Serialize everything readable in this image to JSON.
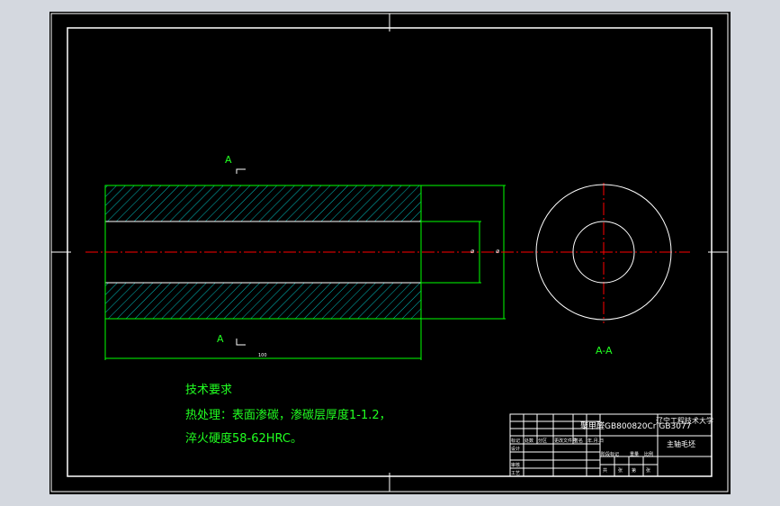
{
  "drawing": {
    "section_mark_top": "A",
    "section_mark_bottom": "A",
    "section_view_label": "A-A",
    "dim_small_1": "⌀",
    "dim_small_2": "⌀",
    "dim_length": "100"
  },
  "notes": {
    "heading": "技术要求",
    "line1": "热处理：表面渗碳，渗碳层厚度1-1.2，",
    "line2": "淬火硬度58-62HRC。"
  },
  "title_block": {
    "material": "20Cr GB3077",
    "material_full": "聚甲醛GB800820Cr GB3077",
    "school": "辽宁工程技术大学",
    "part_name": "主轴毛坯",
    "row_labels": [
      "标记",
      "处数",
      "分区",
      "更改文件号",
      "签名",
      "年.月.日"
    ],
    "left_labels": [
      "设计",
      "审核",
      "工艺"
    ],
    "stage_labels": [
      "阶段标记",
      "重量",
      "比例"
    ],
    "sheet_labels": [
      "共",
      "张",
      "第",
      "张"
    ]
  },
  "colors": {
    "background": "#000000",
    "frame": "#ffffff",
    "geometry": "#00ff00",
    "centerline": "#ff0000",
    "hatch": "#00bcbc",
    "text": "#21ff21"
  }
}
